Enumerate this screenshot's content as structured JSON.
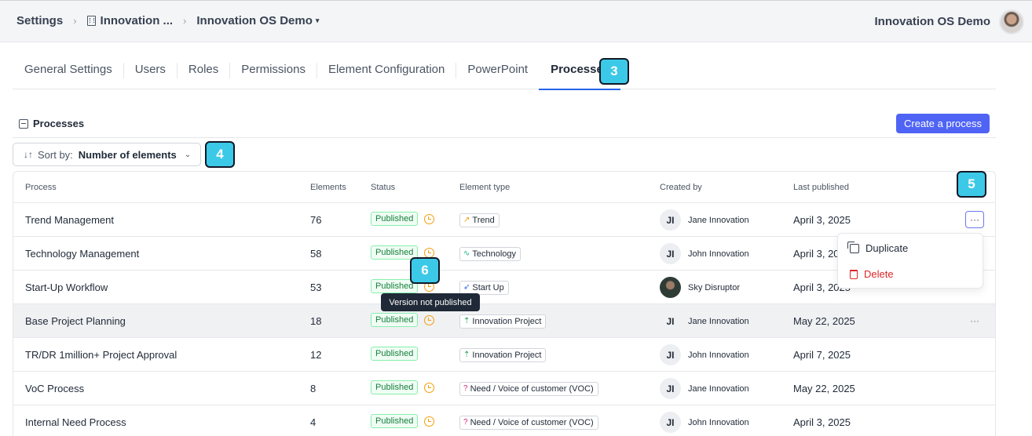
{
  "header": {
    "breadcrumb": [
      "Settings",
      "Innovation ...",
      "Innovation OS Demo"
    ],
    "org_name": "Innovation OS Demo"
  },
  "tabs": [
    "General Settings",
    "Users",
    "Roles",
    "Permissions",
    "Element Configuration",
    "PowerPoint",
    "Processes"
  ],
  "active_tab": "Processes",
  "badges": [
    "3",
    "4",
    "5",
    "6"
  ],
  "section": {
    "title": "Processes",
    "create_label": "Create a process"
  },
  "sort": {
    "label": "Sort by:",
    "value": "Number of elements"
  },
  "table": {
    "columns": [
      "Process",
      "Elements",
      "Status",
      "Element type",
      "Created by",
      "Last published"
    ],
    "rows": [
      {
        "process": "Trend Management",
        "elements": "76",
        "status": "Published",
        "clock": true,
        "type": "Trend",
        "type_icon": "trend-icon",
        "by": "Jane Innovation",
        "initials": "JI",
        "date": "April 3, 2025"
      },
      {
        "process": "Technology Management",
        "elements": "58",
        "status": "Published",
        "clock": true,
        "type": "Technology",
        "type_icon": "technology-icon",
        "by": "John Innovation",
        "initials": "JI",
        "date": "April 3, 2025"
      },
      {
        "process": "Start-Up Workflow",
        "elements": "53",
        "status": "Published",
        "clock": true,
        "type": "Start Up",
        "type_icon": "rocket-icon",
        "by": "Sky Disruptor",
        "initials": "",
        "date": "April 3, 2025"
      },
      {
        "process": "Base Project Planning",
        "elements": "18",
        "status": "Published",
        "clock": true,
        "type": "Innovation Project",
        "type_icon": "sprout-icon",
        "by": "Jane Innovation",
        "initials": "JI",
        "date": "May 22, 2025"
      },
      {
        "process": "TR/DR 1million+ Project Approval",
        "elements": "12",
        "status": "Published",
        "clock": false,
        "type": "Innovation Project",
        "type_icon": "sprout-icon",
        "by": "John Innovation",
        "initials": "JI",
        "date": "April 7, 2025"
      },
      {
        "process": "VoC Process",
        "elements": "8",
        "status": "Published",
        "clock": true,
        "type": "Need / Voice of customer (VOC)",
        "type_icon": "question-icon",
        "by": "Jane Innovation",
        "initials": "JI",
        "date": "May 22, 2025"
      },
      {
        "process": "Internal Need Process",
        "elements": "4",
        "status": "Published",
        "clock": true,
        "type": "Need / Voice of customer (VOC)",
        "type_icon": "question-icon",
        "by": "John Innovation",
        "initials": "JI",
        "date": "April 3, 2025"
      }
    ]
  },
  "menu": {
    "duplicate": "Duplicate",
    "delete": "Delete"
  },
  "tooltip": "Version not published",
  "colors": {
    "accent": "#4f63f5",
    "badge": "#3cc9e8",
    "published": "#15803d",
    "clock": "#f59e0b",
    "delete": "#dc2626"
  }
}
